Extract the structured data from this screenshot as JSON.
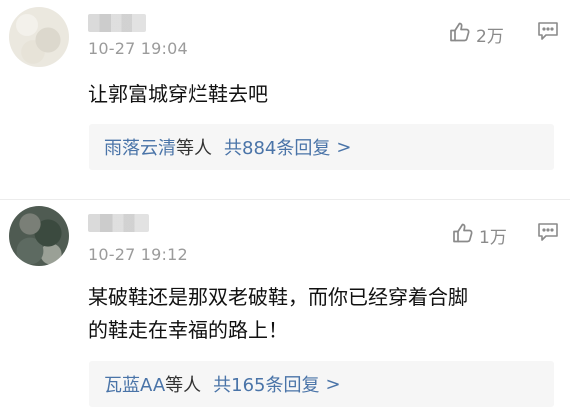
{
  "comments": [
    {
      "timestamp": "10-27 19:04",
      "likes": "2万",
      "body": "让郭富城穿烂鞋去吧",
      "reply": {
        "names": "雨落云清",
        "suffix": "等人",
        "count": "共884条回复",
        "chevron": ">"
      }
    },
    {
      "timestamp": "10-27 19:12",
      "likes": "1万",
      "body": "某破鞋还是那双老破鞋，而你已经穿着合脚\n的鞋走在幸福的路上！",
      "reply": {
        "names": "瓦蓝AA",
        "suffix": "等人",
        "count": "共165条回复",
        "chevron": ">"
      }
    }
  ],
  "colors": {
    "link": "#4a74a8",
    "muted": "#9b9b9b",
    "reply_bg": "#f6f6f6"
  },
  "icons": {
    "like": "thumbs-up-icon",
    "more": "comment-menu-icon"
  }
}
